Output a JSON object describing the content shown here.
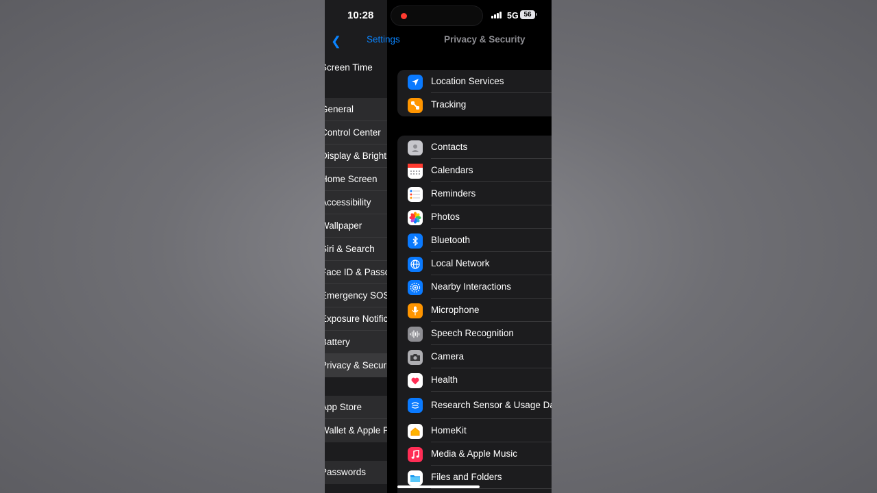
{
  "status": {
    "time": "10:28",
    "network": "5G",
    "battery": "56"
  },
  "nav": {
    "back_label": "Settings",
    "title": "Privacy & Security"
  },
  "settings_list": {
    "groups": [
      [
        "Screen Time"
      ],
      [
        "General",
        "Control Center",
        "Display & Brightness",
        "Home Screen",
        "Accessibility",
        "Wallpaper",
        "Siri & Search",
        "Face ID & Passcode",
        "Emergency SOS",
        "Exposure Notifications",
        "Battery",
        "Privacy & Security"
      ],
      [
        "App Store",
        "Wallet & Apple Pay"
      ],
      [
        "Passwords"
      ]
    ],
    "selected": "Privacy & Security"
  },
  "privacy": {
    "top_group": [
      {
        "label": "Location Services",
        "icon": "location-arrow-icon",
        "color": "#0a7aff"
      },
      {
        "label": "Tracking",
        "icon": "tracking-icon",
        "color": "#ff9500"
      }
    ],
    "permissions": [
      {
        "label": "Contacts",
        "icon": "contacts-icon",
        "color": "#c7c7cc"
      },
      {
        "label": "Calendars",
        "icon": "calendar-icon",
        "color": "#ffffff"
      },
      {
        "label": "Reminders",
        "icon": "reminders-icon",
        "color": "#ffffff"
      },
      {
        "label": "Photos",
        "icon": "photos-icon",
        "color": "#ffffff"
      },
      {
        "label": "Bluetooth",
        "icon": "bluetooth-icon",
        "color": "#0a7aff"
      },
      {
        "label": "Local Network",
        "icon": "globe-icon",
        "color": "#0a7aff"
      },
      {
        "label": "Nearby Interactions",
        "icon": "nearby-icon",
        "color": "#0a7aff"
      },
      {
        "label": "Microphone",
        "icon": "microphone-icon",
        "color": "#ff9500"
      },
      {
        "label": "Speech Recognition",
        "icon": "waveform-icon",
        "color": "#8e8e93"
      },
      {
        "label": "Camera",
        "icon": "camera-icon",
        "color": "#8e8e93"
      },
      {
        "label": "Health",
        "icon": "heart-icon",
        "color": "#ffffff"
      },
      {
        "label": "Research Sensor & Usage Data",
        "icon": "research-icon",
        "color": "#0a7aff"
      },
      {
        "label": "HomeKit",
        "icon": "home-icon",
        "color": "#ffffff"
      },
      {
        "label": "Media & Apple Music",
        "icon": "music-note-icon",
        "color": "#ff2d55"
      },
      {
        "label": "Files and Folders",
        "icon": "folder-icon",
        "color": "#ffffff"
      }
    ]
  }
}
